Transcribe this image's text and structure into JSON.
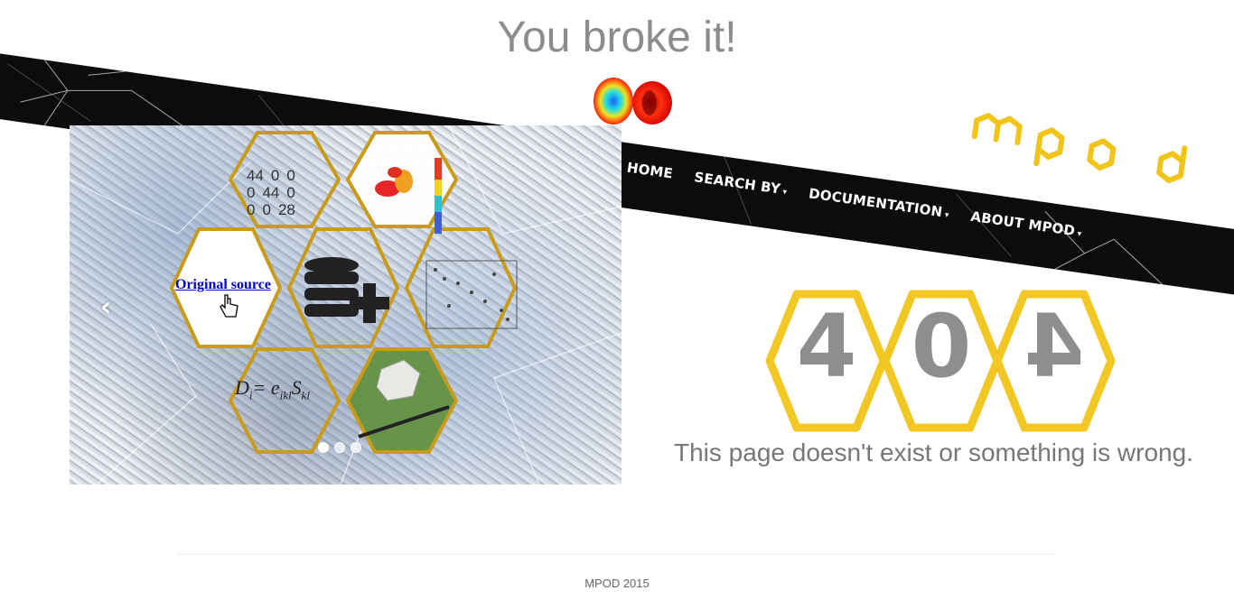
{
  "page": {
    "title": "You broke it!"
  },
  "nav": {
    "items": [
      {
        "label": "HOME",
        "has_caret": false
      },
      {
        "label": "SEARCH BY",
        "has_caret": true
      },
      {
        "label": "DOCUMENTATION",
        "has_caret": true
      },
      {
        "label": "ABOUT MPOD",
        "has_caret": true
      }
    ],
    "caret_glyph": "▾"
  },
  "brand": {
    "logo_text": "mpod",
    "accent_color": "#f0c419"
  },
  "carousel": {
    "prev_icon": "chevron-left-icon",
    "prev_glyph": "‹",
    "link_label": "Original source",
    "matrix": {
      "rows": [
        [
          "44",
          "0",
          "0"
        ],
        [
          "0",
          "44",
          "0"
        ],
        [
          "0",
          "0",
          "28"
        ]
      ]
    },
    "formula": {
      "lhs": "D",
      "lhs_sub": "i",
      "eq": "= e",
      "e_sub": "ikl",
      "s": "S",
      "s_sub": "kl"
    },
    "slides_count": 3,
    "active_slide": 1
  },
  "error": {
    "digits": [
      "4",
      "0",
      "4"
    ],
    "hex_color": "#f2c418",
    "message": "This page doesn't exist or something is wrong."
  },
  "footer": {
    "text": "MPOD 2015"
  }
}
